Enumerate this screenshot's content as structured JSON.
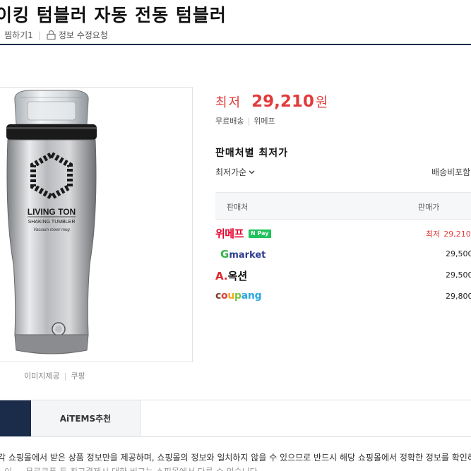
{
  "product": {
    "title": "이킹 텀블러 자동 전동 텀블러",
    "wishlist_label": "찜하기",
    "wishlist_count": "1",
    "edit_request_label": "정보 수정요청",
    "image_caption_label": "이미지제공",
    "image_caption_source": "쿠팡",
    "image_text": {
      "brand": "LIVING TON",
      "subtitle": "SHAKING TUMBLER",
      "tagline": "Vacuum mixer mug"
    }
  },
  "price": {
    "label": "최저",
    "value": "29,210",
    "unit": "원",
    "shipping": "무료배송",
    "seller": "위메프"
  },
  "sellers_section": {
    "title": "판매처별 최저가",
    "sort_label": "최저가순",
    "shipping_filter_label": "배송비포함",
    "col_seller": "판매처",
    "col_price": "판매가",
    "rows": [
      {
        "seller": "위메프",
        "badge": "N Pay",
        "lowest_label": "최저",
        "price": "29,210"
      },
      {
        "seller": "Gmarket",
        "price": "29,500"
      },
      {
        "seller": "옥션",
        "price": "29,500"
      },
      {
        "seller": "coupang",
        "price": "29,800"
      }
    ]
  },
  "bottom_tabs": {
    "aitems_label": "AiTEMS추천"
  },
  "notice": {
    "line1": "각 쇼핑몰에서 받은 상품 정보만을 제공하며, 쇼핑몰의 정보와 일치하지 않을 수 있으므로 반드시 해당 쇼핑몰에서 정확한 정보를 확인하시기",
    "line2": "이 ... 무료쿠폰 등 최고결제시 대한 비교는 쇼핑몰에서 다를 수 있습니다."
  },
  "colors": {
    "accent_red": "#e23b3b",
    "navy": "#1b2b4a",
    "npay_green": "#20c35a"
  }
}
